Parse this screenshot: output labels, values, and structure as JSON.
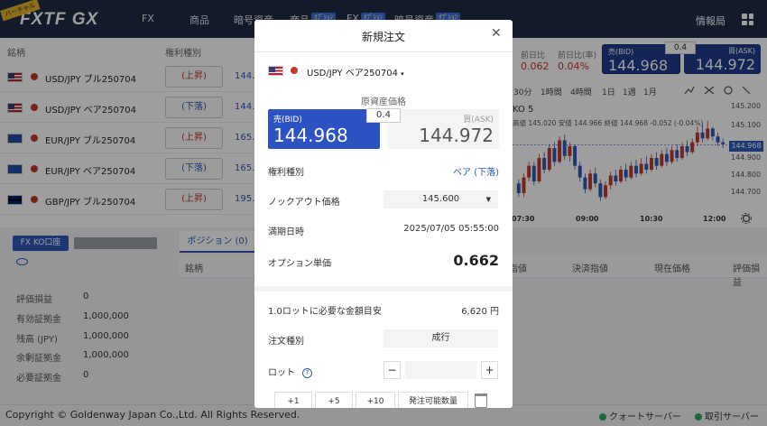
{
  "header": {
    "logo": "FXTF GX",
    "badge": "バーチャル",
    "nav": [
      {
        "label": "FX",
        "tag": ""
      },
      {
        "label": "商品",
        "tag": ""
      },
      {
        "label": "暗号資産",
        "tag": ""
      },
      {
        "label": "商品",
        "tag": "ｵﾌﾟｼｮﾝ"
      },
      {
        "label": "FX",
        "tag": "ｵﾌﾟｼｮﾝ"
      },
      {
        "label": "暗号資産",
        "tag": "ｵﾌﾟｼｮﾝ"
      }
    ],
    "info": "情報局"
  },
  "instrument_list": {
    "col_symbol": "銘柄",
    "col_type": "権利種別",
    "rows": [
      {
        "name": "USD/JPY ブル250704",
        "btn": "(上昇)",
        "dir": "up",
        "price": "144."
      },
      {
        "name": "USD/JPY ベア250704",
        "btn": "(下落)",
        "dir": "dn",
        "price": "144."
      },
      {
        "name": "EUR/JPY ブル250704",
        "btn": "(上昇)",
        "dir": "up",
        "price": "165."
      },
      {
        "name": "EUR/JPY ベア250704",
        "btn": "(下落)",
        "dir": "dn",
        "price": "165."
      },
      {
        "name": "GBP/JPY ブル250704",
        "btn": "(上昇)",
        "dir": "up",
        "price": "195."
      },
      {
        "name": "GBP/JPY ベア250704",
        "btn": "",
        "dir": "dn",
        "price": ""
      }
    ]
  },
  "account": {
    "ko_button": "FX KO口座",
    "summary": [
      {
        "label": "評価損益",
        "value": "0"
      },
      {
        "label": "有効証拠金",
        "value": "1,000,000"
      },
      {
        "label": "残高 (JPY)",
        "value": "1,000,000"
      },
      {
        "label": "余剰証拠金",
        "value": "1,000,000"
      },
      {
        "label": "必要証拠金",
        "value": "0"
      }
    ]
  },
  "positions": {
    "tab": "ポジション (0)",
    "columns": [
      "銘柄",
      "指値",
      "決済指値",
      "現在価格",
      "評価損益"
    ]
  },
  "quote_panel": {
    "prev_day_label": "前日比",
    "prev_day_pct_label": "前日比(率)",
    "prev_day_value": "0.062",
    "prev_day_pct_value": "0.04%",
    "bid_label": "売(BID)",
    "bid_value": "144.968",
    "ask_label": "買(ASK)",
    "ask_value": "144.972",
    "spread": "0.4",
    "timeframes": [
      "30分",
      "1時間",
      "4時間",
      "1日",
      "1週",
      "1月"
    ]
  },
  "chart_data": {
    "type": "candlestick",
    "title": "KO 5",
    "ohlc_text": "高値 145.020 安値 144.966 終値 144.968 -0.052 (-0.04%)",
    "current_price": "144.968",
    "y_ticks": [
      "145.200",
      "145.100",
      "145.000",
      "144.900",
      "144.800",
      "144.700",
      "144.600"
    ],
    "x_ticks": [
      "07:30",
      "09:00",
      "10:30",
      "12:00"
    ],
    "ylim": [
      144.6,
      145.2
    ],
    "candles": [
      [
        144.77,
        144.72,
        144.79,
        144.7
      ],
      [
        144.72,
        144.8,
        144.82,
        144.7
      ],
      [
        144.8,
        144.86,
        144.88,
        144.78
      ],
      [
        144.86,
        144.78,
        144.88,
        144.76
      ],
      [
        144.78,
        144.9,
        144.92,
        144.77
      ],
      [
        144.9,
        144.84,
        144.93,
        144.82
      ],
      [
        144.84,
        144.95,
        144.97,
        144.83
      ],
      [
        144.95,
        144.88,
        144.98,
        144.86
      ],
      [
        144.88,
        144.99,
        145.01,
        144.87
      ],
      [
        144.99,
        144.91,
        145.02,
        144.89
      ],
      [
        144.91,
        144.96,
        144.98,
        144.88
      ],
      [
        144.96,
        144.86,
        144.97,
        144.84
      ],
      [
        144.86,
        144.8,
        144.88,
        144.78
      ],
      [
        144.8,
        144.74,
        144.82,
        144.72
      ],
      [
        144.74,
        144.82,
        144.84,
        144.73
      ],
      [
        144.82,
        144.77,
        144.85,
        144.75
      ],
      [
        144.77,
        144.7,
        144.79,
        144.68
      ],
      [
        144.7,
        144.76,
        144.78,
        144.69
      ],
      [
        144.76,
        144.81,
        144.83,
        144.74
      ],
      [
        144.81,
        144.78,
        144.84,
        144.76
      ],
      [
        144.78,
        144.84,
        144.86,
        144.77
      ],
      [
        144.84,
        144.8,
        144.87,
        144.78
      ],
      [
        144.8,
        144.86,
        144.88,
        144.79
      ],
      [
        144.86,
        144.82,
        144.89,
        144.8
      ],
      [
        144.82,
        144.87,
        144.9,
        144.81
      ],
      [
        144.87,
        144.84,
        144.91,
        144.82
      ],
      [
        144.84,
        144.9,
        144.92,
        144.83
      ],
      [
        144.9,
        144.86,
        144.93,
        144.84
      ],
      [
        144.86,
        144.92,
        144.94,
        144.85
      ],
      [
        144.92,
        144.88,
        144.95,
        144.86
      ],
      [
        144.88,
        144.94,
        144.96,
        144.87
      ],
      [
        144.94,
        144.9,
        144.97,
        144.88
      ],
      [
        144.9,
        144.96,
        144.98,
        144.89
      ],
      [
        144.96,
        144.93,
        144.99,
        144.91
      ],
      [
        144.93,
        144.98,
        145.0,
        144.92
      ],
      [
        144.98,
        145.03,
        145.06,
        144.96
      ],
      [
        145.03,
        145.0,
        145.07,
        144.98
      ],
      [
        145.0,
        145.05,
        145.09,
        144.99
      ],
      [
        145.05,
        145.01,
        145.06,
        144.99
      ],
      [
        145.01,
        144.98,
        145.03,
        144.96
      ],
      [
        144.98,
        144.97,
        145.0,
        144.95
      ]
    ]
  },
  "modal": {
    "title": "新規注文",
    "symbol": "USD/JPY ベア250704",
    "underlying_label": "原資産価格",
    "bid_label": "売(BID)",
    "bid_value": "144.968",
    "ask_label": "買(ASK)",
    "ask_value": "144.972",
    "spread": "0.4",
    "right_type_label": "権利種別",
    "right_type_value": "ベア (下落)",
    "knockout_label": "ノックアウト価格",
    "knockout_value": "145.600",
    "expiry_label": "満期日時",
    "expiry_value": "2025/07/05 05:55:00",
    "option_price_label": "オプション単価",
    "option_price_value": "0.662",
    "required_label": "1.0ロットに必要な金額目安",
    "required_value": "6,620 円",
    "order_type_label": "注文種別",
    "order_type_value": "成行",
    "lot_label": "ロット",
    "lot_value": "",
    "quick_buttons": [
      "+1",
      "+5",
      "+10",
      "発注可能数量"
    ]
  },
  "footer": {
    "copyright": "Copyright © Goldenway Japan Co.,Ltd. All Rights Reserved.",
    "quote_server": "クォートサーバー",
    "trade_server": "取引サーバー"
  },
  "colors": {
    "header": "#1f2a44",
    "accent": "#2e5ab8",
    "up": "#c0392b",
    "down": "#2e5ab8"
  }
}
